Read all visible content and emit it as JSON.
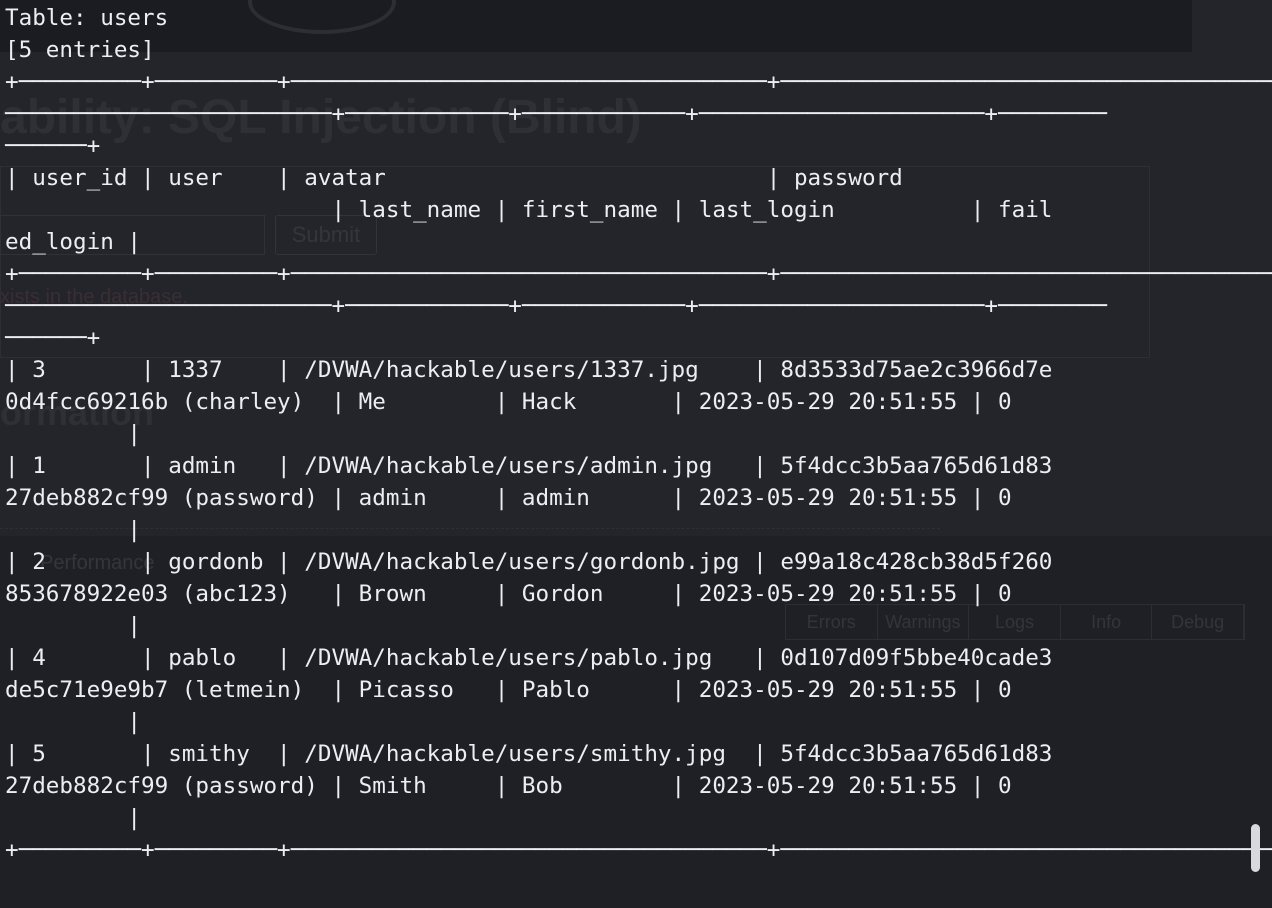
{
  "background_page": {
    "heading": "ability: SQL Injection (Blind)",
    "submit_label": "Submit",
    "result_text": "xists in the database.",
    "info_heading": "ormation",
    "devtools_tab": "Performance",
    "filter_buttons": [
      "Errors",
      "Warnings",
      "Logs",
      "Info",
      "Debug"
    ]
  },
  "terminal": {
    "lines": [
      "Table: users",
      "[5 entries]",
      "+---------+---------+-----------------------------------+-------------------------------------",
      "------------------------+------------+------------+---------------------+--------",
      "------+",
      "| user_id | user    | avatar                            | password",
      "                        | last_name | first_name | last_login          | fail",
      "ed_login |",
      "+---------+---------+-----------------------------------+-------------------------------------",
      "------------------------+------------+------------+---------------------+--------",
      "------+",
      "| 3       | 1337    | /DVWA/hackable/users/1337.jpg    | 8d3533d75ae2c3966d7e",
      "0d4fcc69216b (charley)  | Me        | Hack       | 2023-05-29 20:51:55 | 0",
      "         |",
      "| 1       | admin   | /DVWA/hackable/users/admin.jpg   | 5f4dcc3b5aa765d61d83",
      "27deb882cf99 (password) | admin     | admin      | 2023-05-29 20:51:55 | 0",
      "         |",
      "| 2       | gordonb | /DVWA/hackable/users/gordonb.jpg | e99a18c428cb38d5f260",
      "853678922e03 (abc123)   | Brown     | Gordon     | 2023-05-29 20:51:55 | 0",
      "         |",
      "| 4       | pablo   | /DVWA/hackable/users/pablo.jpg   | 0d107d09f5bbe40cade3",
      "de5c71e9e9b7 (letmein)  | Picasso   | Pablo      | 2023-05-29 20:51:55 | 0",
      "         |",
      "| 5       | smithy  | /DVWA/hackable/users/smithy.jpg  | 5f4dcc3b5aa765d61d83",
      "27deb882cf99 (password) | Smith     | Bob        | 2023-05-29 20:51:55 | 0",
      "         |",
      "+---------+---------+-----------------------------------+-------------------------------------"
    ]
  }
}
